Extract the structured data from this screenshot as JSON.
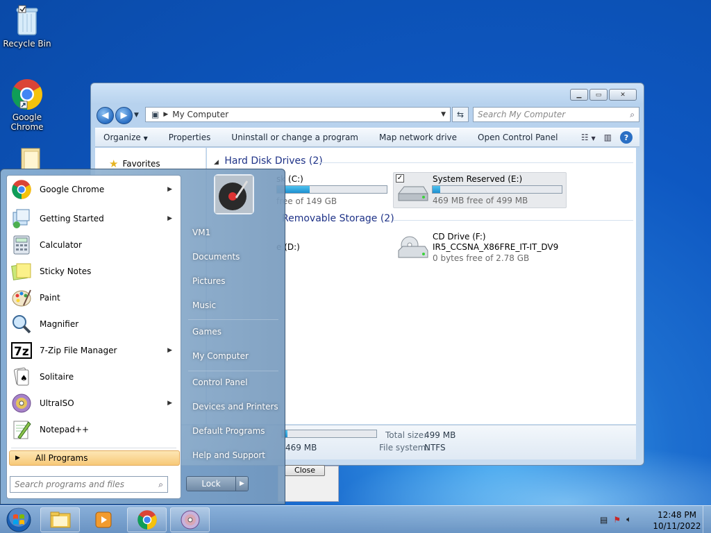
{
  "desktop": {
    "icons": [
      {
        "label": "Recycle Bin"
      },
      {
        "label": "Google Chrome"
      }
    ]
  },
  "explorer": {
    "address": "My Computer",
    "search_placeholder": "Search My Computer",
    "commands": [
      "Organize",
      "Properties",
      "Uninstall or change a program",
      "Map network drive",
      "Open Control Panel"
    ],
    "favorites": "Favorites",
    "groups": {
      "hdd": "Hard Disk Drives (2)",
      "removable": "Removable Storage (2)"
    },
    "drives": {
      "c_name": "sk (C:)",
      "c_free": "free of 149 GB",
      "c_fill": 0.3,
      "e_name": "System Reserved (E:)",
      "e_free": "469 MB free of 499 MB",
      "e_fill": 0.06,
      "d_name": "e (D:)",
      "f_name": "CD Drive (F:)",
      "f_label": "IR5_CCSNA_X86FRE_IT-IT_DV9",
      "f_free": "0 bytes free of 2.78 GB"
    },
    "details": {
      "total_size_label": "Total size:",
      "total_size": "499 MB",
      "fs_label": "File system:",
      "fs": "NTFS",
      "free_partial": "469 MB",
      "bar_fill": 0.06
    },
    "close_label": "Close"
  },
  "start_menu": {
    "programs": [
      {
        "label": "Google Chrome",
        "submenu": true
      },
      {
        "label": "Getting Started",
        "submenu": true
      },
      {
        "label": "Calculator",
        "submenu": false
      },
      {
        "label": "Sticky Notes",
        "submenu": false
      },
      {
        "label": "Paint",
        "submenu": false
      },
      {
        "label": "Magnifier",
        "submenu": false
      },
      {
        "label": "7-Zip File Manager",
        "submenu": true
      },
      {
        "label": "Solitaire",
        "submenu": false
      },
      {
        "label": "UltraISO",
        "submenu": true
      },
      {
        "label": "Notepad++",
        "submenu": false
      }
    ],
    "all_programs": "All Programs",
    "search_placeholder": "Search programs and files",
    "right_items": [
      "VM1",
      "Documents",
      "Pictures",
      "Music",
      "Games",
      "My Computer",
      "Control Panel",
      "Devices and Printers",
      "Default Programs",
      "Help and Support"
    ],
    "lock_label": "Lock"
  },
  "taskbar": {
    "time": "12:48 PM",
    "date": "10/11/2022"
  }
}
